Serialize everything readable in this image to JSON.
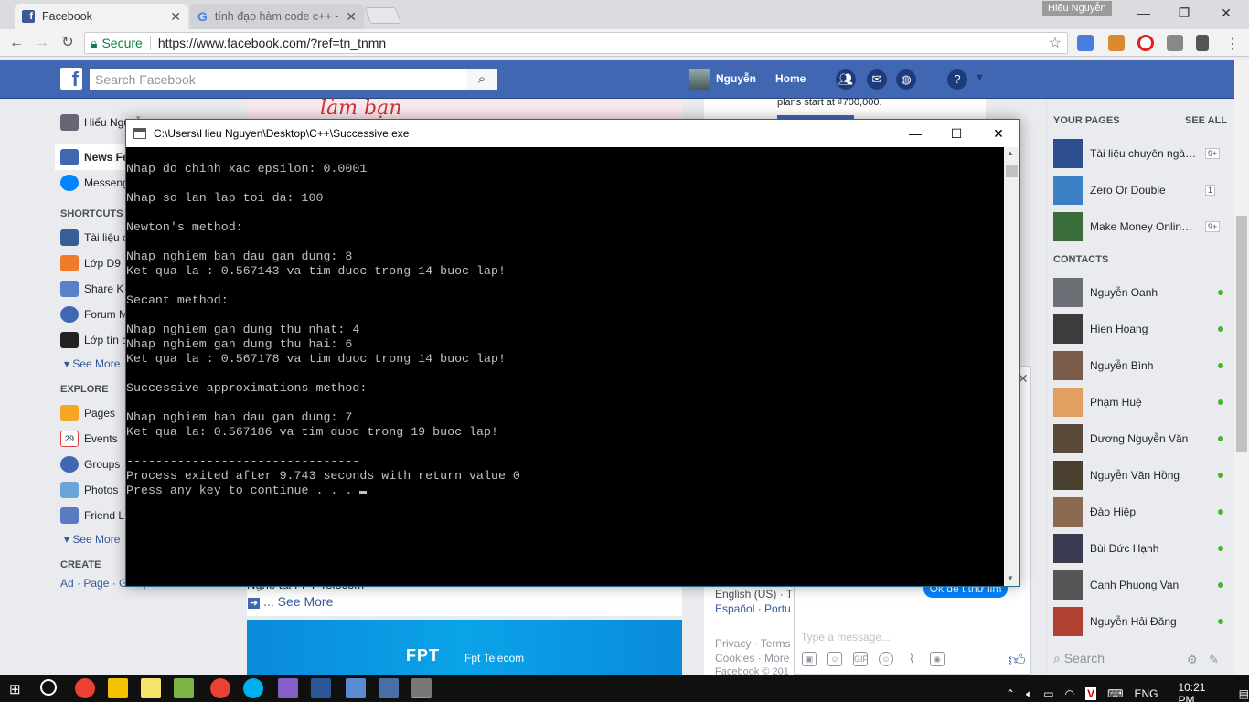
{
  "browser": {
    "tabs": [
      {
        "title": "Facebook",
        "icon": "facebook-icon"
      },
      {
        "title": "tính đạo hàm code c++ -",
        "icon": "google-icon"
      }
    ],
    "window_user": "Hiếu Nguyễn",
    "secure_label": "Secure",
    "url": "https://www.facebook.com/?ref=tn_tnmn"
  },
  "fb": {
    "logo": "f",
    "search_placeholder": "Search Facebook",
    "user_name": "Nguyễn",
    "home_label": "Home"
  },
  "left_nav": {
    "profile": "Hiếu Nguyễ",
    "news_feed": "News Fe",
    "messenger": "Messeng",
    "shortcuts_head": "SHORTCUTS",
    "shortcuts": [
      "Tài liệu c",
      "Lớp D9",
      "Share K",
      "Forum M",
      "Lớp tín c"
    ],
    "see_more": "See More",
    "explore_head": "EXPLORE",
    "explore": [
      "Pages",
      "Events",
      "Groups",
      "Photos",
      "Friend L"
    ],
    "events_day": "29",
    "create_head": "CREATE",
    "create_links": "Ad · Page · Group · Event"
  },
  "feed": {
    "top_fragment": "làm bạn",
    "post_fragment": "Nghe tại FPT Telecom",
    "see_more": "... See More",
    "ad_brand": "FPT",
    "ad_text": "Fpt Telecom"
  },
  "right_column": {
    "plans": "plans start at ₫700,000.",
    "lang_line1": "English (US) · T",
    "lang_line2": "Español · Portu",
    "privacy": "Privacy · Terms",
    "cookies": "Cookies · More",
    "copyright": "Facebook © 201"
  },
  "chat": {
    "pill": "Ok để t thử lim",
    "placeholder": "Type a message...",
    "tools": [
      "photo-icon",
      "sticker-icon",
      "gif-icon",
      "emoji-icon",
      "attach-icon",
      "camera-icon"
    ],
    "gif_label": "GIF"
  },
  "sidebar": {
    "pages_head": "YOUR PAGES",
    "see_all": "SEE ALL",
    "pages": [
      {
        "name": "Tài liệu chuyên ngàn...",
        "count": "9+",
        "color": "#2d4f8f"
      },
      {
        "name": "Zero Or Double",
        "count": "1",
        "color": "#3b7fc4"
      },
      {
        "name": "Make Money Online ...",
        "count": "9+",
        "color": "#3b6d3b"
      }
    ],
    "contacts_head": "CONTACTS",
    "contacts": [
      {
        "name": "Nguyễn Oanh",
        "color": "#6b6f75"
      },
      {
        "name": "Hien Hoang",
        "color": "#3c3c3c"
      },
      {
        "name": "Nguyễn Bình",
        "color": "#7a5a48"
      },
      {
        "name": "Phạm Huệ",
        "color": "#e0a060"
      },
      {
        "name": "Dương Nguyễn Văn",
        "color": "#5a4a3a"
      },
      {
        "name": "Nguyễn Văn Hồng",
        "color": "#4a4030"
      },
      {
        "name": "Đào Hiệp",
        "color": "#8a6a50"
      },
      {
        "name": "Bùi Đức Hạnh",
        "color": "#3a3a50"
      },
      {
        "name": "Canh Phuong Van",
        "color": "#555"
      },
      {
        "name": "Nguyễn Hải Đăng",
        "color": "#b04030"
      }
    ],
    "search": "Search"
  },
  "console": {
    "title": "C:\\Users\\Hieu Nguyen\\Desktop\\C++\\Successive.exe",
    "lines": [
      "Nhap do chinh xac epsilon: 0.0001",
      "",
      "Nhap so lan lap toi da: 100",
      "",
      "Newton's method:",
      "",
      "Nhap nghiem ban dau gan dung: 8",
      "Ket qua la : 0.567143 va tim duoc trong 14 buoc lap!",
      "",
      "Secant method:",
      "",
      "Nhap nghiem gan dung thu nhat: 4",
      "Nhap nghiem gan dung thu hai: 6",
      "Ket qua la : 0.567178 va tim duoc trong 14 buoc lap!",
      "",
      "Successive approximations method:",
      "",
      "Nhap nghiem ban dau gan dung: 7",
      "Ket qua la: 0.567186 va tim duoc trong 19 buoc lap!",
      "",
      "--------------------------------",
      "Process exited after 9.743 seconds with return value 0",
      "Press any key to continue . . . "
    ]
  },
  "taskbar": {
    "lang": "ENG",
    "time": "10:21 PM"
  }
}
